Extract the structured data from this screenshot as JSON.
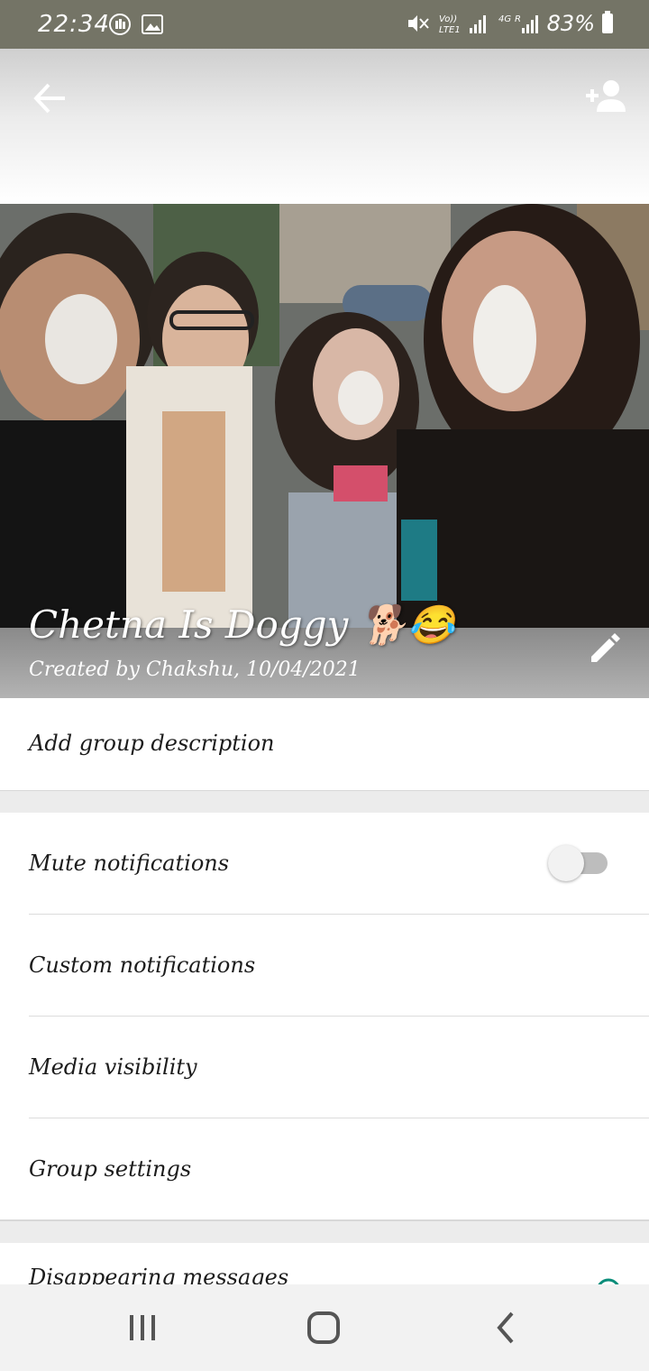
{
  "status_bar": {
    "time": "22:34",
    "battery": "83%",
    "network_labels": [
      "Vo)) LTE1",
      "4G",
      "R"
    ]
  },
  "toolbar": {
    "back_icon": "arrow-back-icon",
    "add_participant_icon": "add-person-icon"
  },
  "group": {
    "name": "Chetna Is Doggy 🐕😂",
    "created": "Created by Chakshu, 10/04/2021",
    "edit_icon": "pencil-icon"
  },
  "description": {
    "label": "Add group description"
  },
  "settings": {
    "mute": "Mute notifications",
    "mute_enabled": false,
    "custom": "Custom notifications",
    "media": "Media visibility",
    "group_settings": "Group settings"
  },
  "next_section": {
    "disappearing": "Disappearing messages"
  },
  "nav": {
    "recents_icon": "recents-icon",
    "home_icon": "home-icon",
    "back_icon": "nav-back-icon"
  },
  "colors": {
    "status_bar": "#747466",
    "toggle_track": "#bdbdbd",
    "accent_teal": "#0b8d7a"
  }
}
